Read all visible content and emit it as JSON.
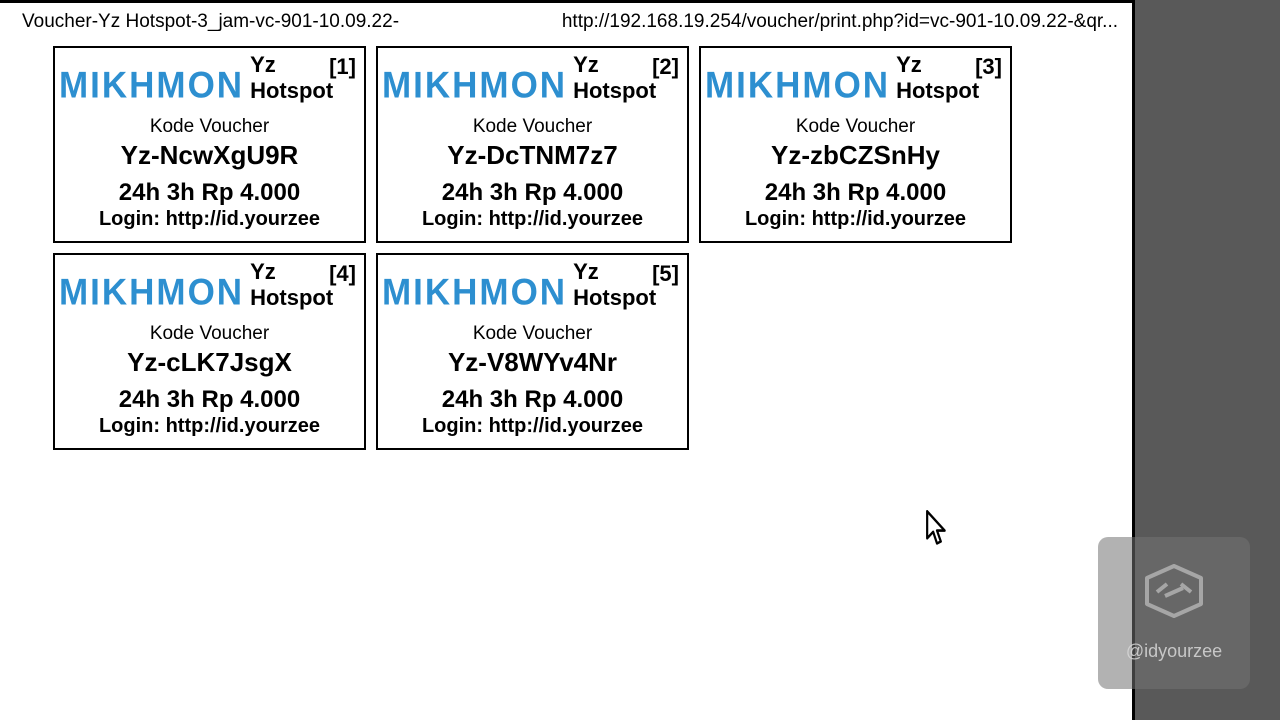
{
  "header": {
    "title": "Voucher-Yz Hotspot-3_jam-vc-901-10.09.22-",
    "url": "http://192.168.19.254/voucher/print.php?id=vc-901-10.09.22-&qr..."
  },
  "voucher_common": {
    "brand": "MIKHMON",
    "hotspot": "Yz Hotspot",
    "kode_label": "Kode Voucher",
    "price_line": "24h 3h Rp 4.000",
    "login_line": "Login: http://id.yourzee"
  },
  "vouchers": [
    {
      "idx": "[1]",
      "code": "Yz-NcwXgU9R"
    },
    {
      "idx": "[2]",
      "code": "Yz-DcTNM7z7"
    },
    {
      "idx": "[3]",
      "code": "Yz-zbCZSnHy"
    },
    {
      "idx": "[4]",
      "code": "Yz-cLK7JsgX"
    },
    {
      "idx": "[5]",
      "code": "Yz-V8WYv4Nr"
    }
  ],
  "watermark": {
    "handle": "@idyourzee"
  }
}
